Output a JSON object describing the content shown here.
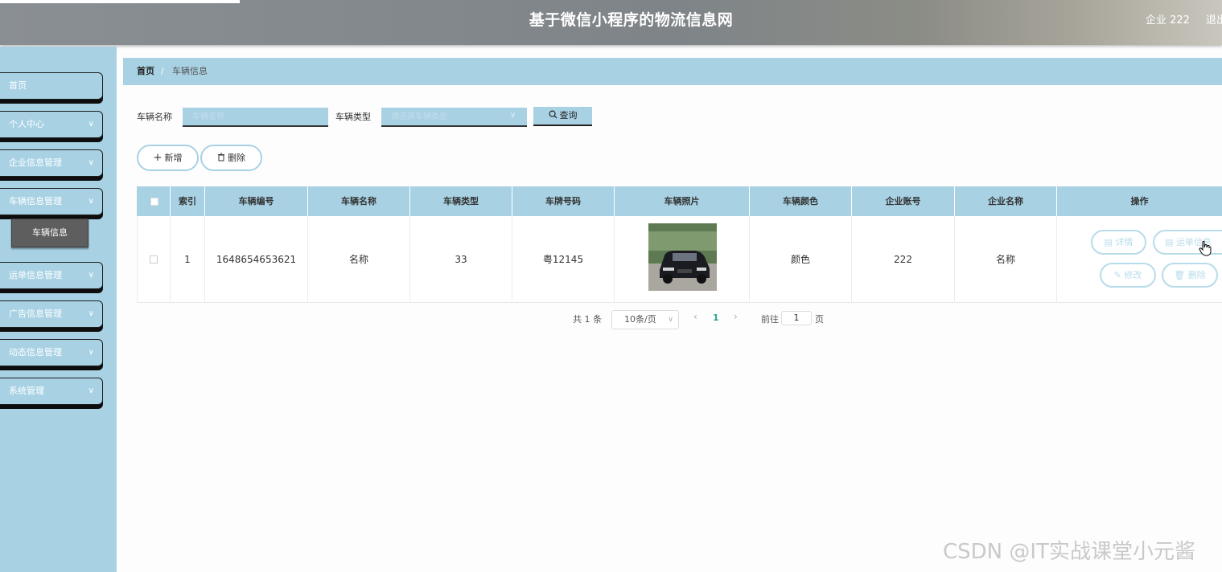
{
  "header": {
    "title": "基于微信小程序的物流信息网",
    "user": "企业 222",
    "logout": "退出"
  },
  "sidebar": {
    "items": [
      {
        "label": "首页",
        "chevron": ""
      },
      {
        "label": "个人中心",
        "chevron": "∨"
      },
      {
        "label": "企业信息管理",
        "chevron": "∨"
      },
      {
        "label": "车辆信息管理",
        "chevron": "∨"
      },
      {
        "label": "运单信息管理",
        "chevron": "∨"
      },
      {
        "label": "广告信息管理",
        "chevron": "∨"
      },
      {
        "label": "动态信息管理",
        "chevron": "∨"
      },
      {
        "label": "系统管理",
        "chevron": "∨"
      }
    ],
    "submenu": {
      "label": "车辆信息"
    }
  },
  "breadcrumb": {
    "home": "首页",
    "separator": "/",
    "current": "车辆信息"
  },
  "search": {
    "name_label": "车辆名称",
    "name_placeholder": "车辆名称",
    "type_label": "车辆类型",
    "type_placeholder": "请选择车辆类型",
    "query_button": "查询"
  },
  "actions": {
    "add": "新增",
    "delete": "删除"
  },
  "table": {
    "headers": [
      "索引",
      "车辆编号",
      "车辆名称",
      "车辆类型",
      "车牌号码",
      "车辆照片",
      "车辆颜色",
      "企业账号",
      "企业名称",
      "操作"
    ],
    "rows": [
      {
        "index": "1",
        "vehicle_no": "1648654653621",
        "vehicle_name": "名称",
        "vehicle_type": "33",
        "plate": "粤12145",
        "color": "颜色",
        "company_account": "222",
        "company_name": "名称",
        "ops": {
          "detail": "详情",
          "waybill": "运单信息",
          "edit": "修改",
          "delete": "删除"
        }
      }
    ]
  },
  "pagination": {
    "total": "共 1 条",
    "page_size": "10条/页",
    "current_page": "1",
    "goto_label": "前往",
    "goto_value": "1",
    "page_suffix": "页"
  },
  "watermark": "CSDN @IT实战课堂小元酱",
  "colors": {
    "accent": "#a8d2e4",
    "submenu_active": "#5e5e5e",
    "pager_active": "#2aa59a"
  }
}
